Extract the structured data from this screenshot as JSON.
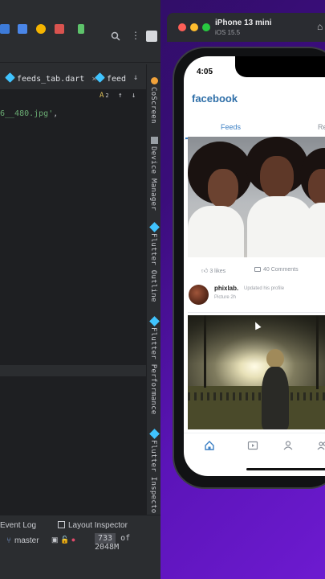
{
  "ide": {
    "tabs": [
      {
        "label": "feeds_tab.dart",
        "close": "×"
      },
      {
        "label": "feed"
      }
    ],
    "editor": {
      "code_line": "6__480.jpg'",
      "code_suffix": ","
    },
    "inspection": {
      "label": "A",
      "count": "2"
    },
    "side_tools": [
      "CoScreen",
      "Device Manager",
      "Flutter Outline",
      "Flutter Performance",
      "Flutter Inspector"
    ],
    "bottom_tools": [
      "Event Log",
      "Layout Inspector"
    ],
    "status": {
      "branch": "master",
      "memory_used": "733",
      "memory_total": "of 2048M"
    },
    "colors": {
      "string": "#6aab73",
      "dart": "#40c4ff"
    }
  },
  "simulator": {
    "device": "iPhone 13 mini",
    "os": "iOS 15.5"
  },
  "app": {
    "time": "4:05",
    "title": "facebook",
    "tabs": [
      "Feeds",
      "Re"
    ],
    "post1": {
      "likes": "3  likes",
      "comments": "40 Comments"
    },
    "post2": {
      "author": "phixlab.",
      "action": "Updated his profile",
      "time": "Picture 2h"
    },
    "nav": [
      "home-icon",
      "video-icon",
      "profile-icon",
      "friends-icon"
    ],
    "colors": {
      "brand": "#2f6fa8",
      "tab_active": "#3b7fc4"
    }
  }
}
